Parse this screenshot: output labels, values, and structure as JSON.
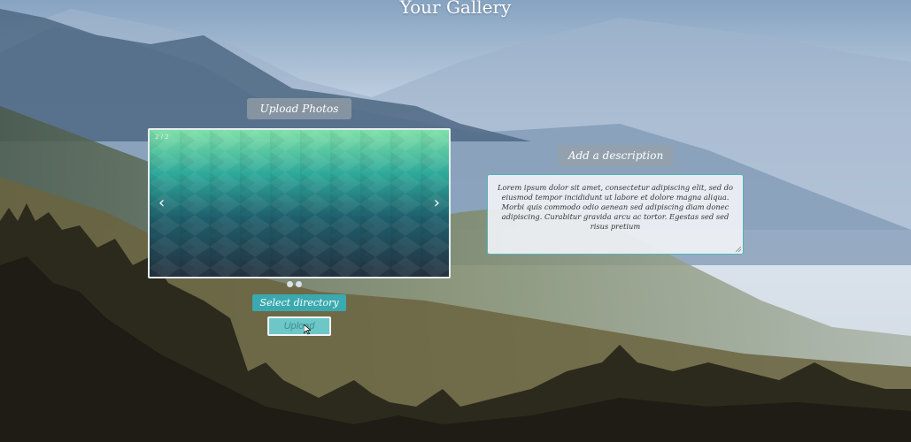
{
  "page": {
    "title": "Your Gallery"
  },
  "uploader": {
    "label": "Upload Photos",
    "slide_counter": "2 / 2",
    "prev_arrow": "‹",
    "next_arrow": "›",
    "dot_count": 2,
    "select_directory": "Select directory",
    "upload": "Upload"
  },
  "description": {
    "label": "Add a description",
    "text": "Lorem ipsum dolor sit amet, consectetur adipiscing elit, sed do eiusmod tempor incididunt ut labore et dolore magna aliqua. Morbi quis commodo odio aenean sed adipiscing diam donec adipiscing. Curabitur gravida arcu ac tortor. Egestas sed sed risus pretium"
  },
  "colors": {
    "accent": "#3aa9b0",
    "upload_bg": "#6cc7c6",
    "text_border": "#4fb4b8"
  }
}
